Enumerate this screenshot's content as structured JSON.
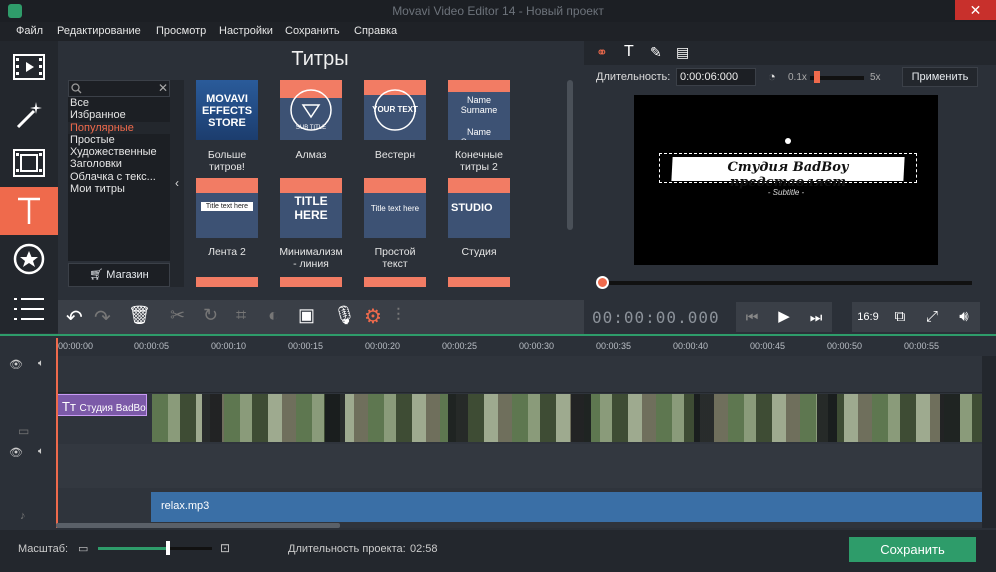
{
  "window": {
    "title": "Movavi Video Editor 14 - Новый проект"
  },
  "menu": [
    "Файл",
    "Редактирование",
    "Просмотр",
    "Настройки",
    "Сохранить",
    "Справка"
  ],
  "tools": [
    {
      "icon": "film-import-icon"
    },
    {
      "icon": "magic-wand-icon"
    },
    {
      "icon": "filters-icon"
    },
    {
      "icon": "titles-icon"
    },
    {
      "icon": "stickers-icon"
    },
    {
      "icon": "more-menu-icon"
    }
  ],
  "titles_panel": {
    "heading": "Титры",
    "categories": [
      "Все",
      "Избранное",
      "Популярные",
      "Простые",
      "Художественные",
      "Заголовки",
      "Облачка с текс...",
      "Мои титры"
    ],
    "selected_category": "Популярные",
    "shop_label": "Магазин",
    "items": [
      {
        "label": "Больше\nтитров!",
        "thumb_text": "MOVAVI EFFECTS STORE"
      },
      {
        "label": "Алмаз",
        "thumb_text": "SUB TITLE"
      },
      {
        "label": "Вестерн",
        "thumb_text": "YOUR TEXT"
      },
      {
        "label": "Конечные\nтитры 2",
        "thumb_text": "Name Surname"
      },
      {
        "label": "Лента 2",
        "thumb_text": "Title text here"
      },
      {
        "label": "Минимализм\n- линия",
        "thumb_text": "TITLE HERE"
      },
      {
        "label": "Простой\nтекст",
        "thumb_text": "Title text here"
      },
      {
        "label": "Студия",
        "thumb_text": "STUDIO"
      }
    ]
  },
  "preview": {
    "duration_label": "Длительность:",
    "duration_value": "0:00:06:000",
    "speed_min": "0.1x",
    "speed_max": "5x",
    "apply_label": "Применить",
    "banner_text": "Студия BadBoy представляет",
    "subtitle_text": "- Subtitle -",
    "progress": 0.0
  },
  "player": {
    "timecode": "00:00:00.000",
    "aspect_label": "16:9"
  },
  "timeline": {
    "ticks": [
      "00:00:00",
      "00:00:05",
      "00:00:10",
      "00:00:15",
      "00:00:20",
      "00:00:25",
      "00:00:30",
      "00:00:35",
      "00:00:40",
      "00:00:45",
      "00:00:50",
      "00:00:55"
    ],
    "title_clip": "Студия BadBoy",
    "audio_clip": "relax.mp3"
  },
  "bottom": {
    "scale_label": "Масштаб:",
    "project_duration_label": "Длительность проекта:",
    "project_duration_value": "02:58",
    "save_label": "Сохранить"
  },
  "colors": {
    "accent": "#ef6a4c",
    "green": "#2e9c6a",
    "audio": "#3a6fa6",
    "title_clip": "#7c5aa8"
  }
}
